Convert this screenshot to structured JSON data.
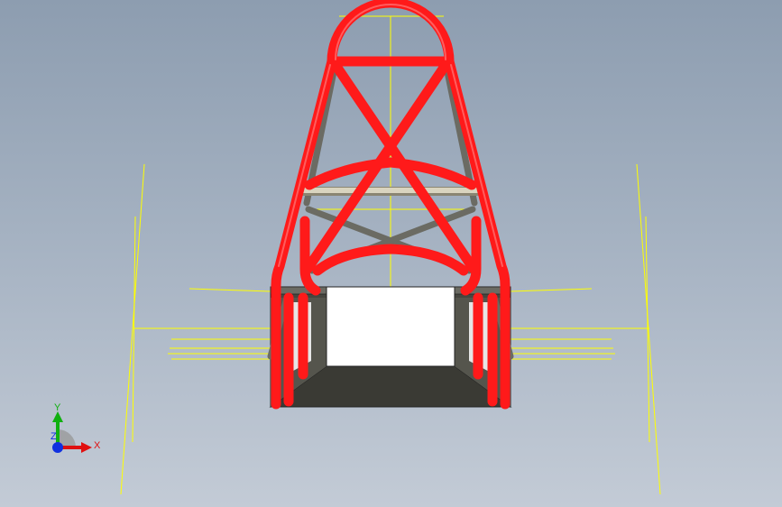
{
  "viewport": {
    "background_top": "#8d9db0",
    "background_bottom": "#c3cbd6"
  },
  "model": {
    "tube_color": "#ff1a1a",
    "tube_highlight": "#ff7a7a",
    "secondary_tube_color": "#6b6b63",
    "crossbar_color": "#c9c4ad",
    "panel_color": "#46463f",
    "panel_face_color": "#ffffff",
    "sketch_line_color": "#ffff00"
  },
  "triad": {
    "x_label": "X",
    "y_label": "Y",
    "z_label": "Z",
    "x_color": "#e01010",
    "y_color": "#10b010",
    "z_color": "#1030e0",
    "icons": {
      "x": "arrow-right-icon",
      "y": "arrow-up-icon",
      "z": "dot-icon"
    }
  }
}
